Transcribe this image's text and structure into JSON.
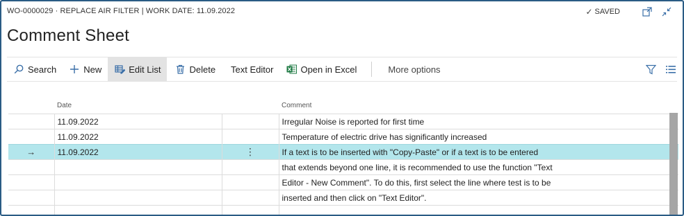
{
  "header": {
    "breadcrumb": "WO-0000029 · REPLACE AIR FILTER | WORK DATE: 11.09.2022",
    "saved_check": "✓",
    "saved_label": "SAVED",
    "open_new_window_icon": "open-new-window-icon",
    "collapse_icon": "collapse-icon"
  },
  "page": {
    "title": "Comment Sheet"
  },
  "actions": {
    "search": "Search",
    "new": "New",
    "edit_list": "Edit List",
    "delete": "Delete",
    "text_editor": "Text Editor",
    "open_in_excel": "Open in Excel",
    "more_options": "More options",
    "filter_icon": "filter-icon",
    "list_icon": "list-view-icon"
  },
  "table": {
    "columns": [
      "Date",
      "Comment"
    ],
    "rows": [
      {
        "arrow": "",
        "date": "11.09.2022",
        "menu": "",
        "comment": "Irregular Noise is reported for first time"
      },
      {
        "arrow": "",
        "date": "11.09.2022",
        "menu": "",
        "comment": "Temperature of electric drive has significantly increased"
      },
      {
        "arrow": "→",
        "date": "11.09.2022",
        "menu": "⋮",
        "comment": "If a text is to be inserted with \"Copy-Paste\" or if a text is to be entered"
      },
      {
        "arrow": "",
        "date": "",
        "menu": "",
        "comment": "that extends beyond one line, it is recommended to use the function \"Text"
      },
      {
        "arrow": "",
        "date": "",
        "menu": "",
        "comment": "Editor - New Comment\". To do this, first select the line where test is to be"
      },
      {
        "arrow": "",
        "date": "",
        "menu": "",
        "comment": "inserted and then click on \"Text Editor\"."
      },
      {
        "arrow": "",
        "date": "",
        "menu": "",
        "comment": ""
      }
    ]
  },
  "colors": {
    "frame_border": "#2a5b84",
    "selected_row": "#b3e6ec",
    "accent_blue": "#3a6fa8",
    "excel_green": "#1d7a43"
  }
}
